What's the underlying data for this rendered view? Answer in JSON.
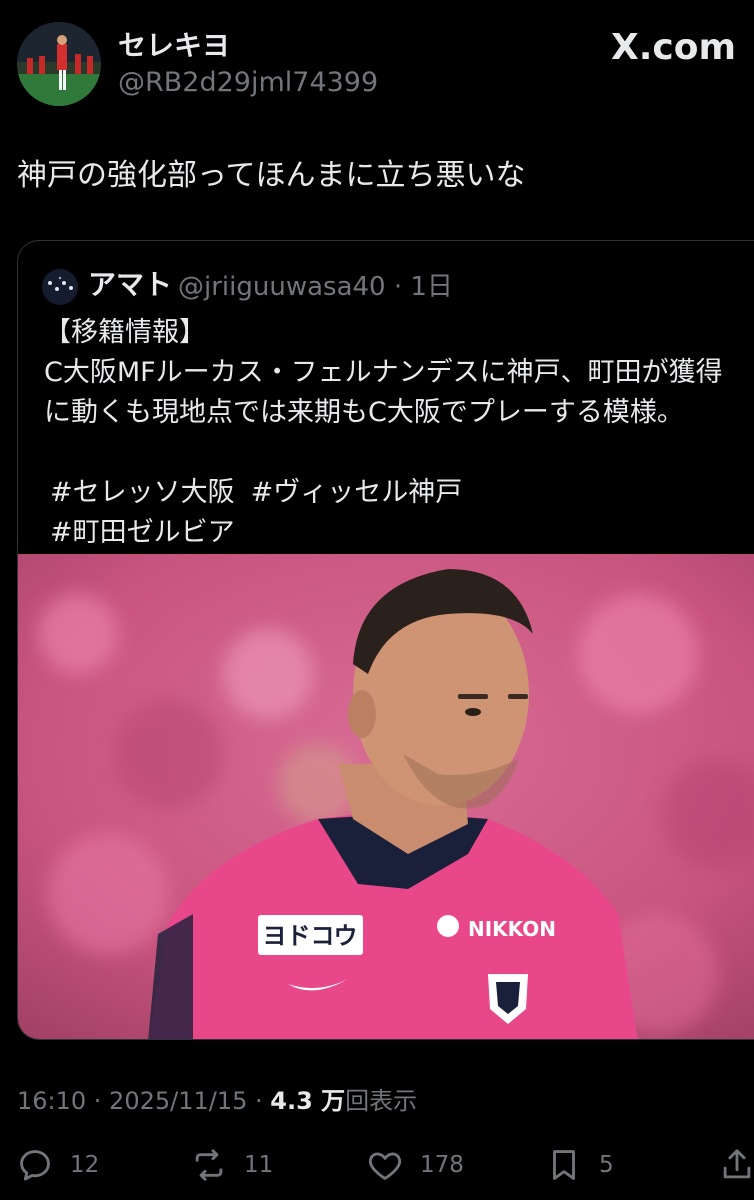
{
  "author": {
    "display_name": "セレキヨ",
    "handle": "@RB2d29jml74399",
    "avatar_icon": "soccer-players-photo"
  },
  "brand": {
    "logo_text": "X.com"
  },
  "tweet": {
    "text": "神戸の強化部ってほんまに立ち悪いな"
  },
  "quoted": {
    "name": "アマト",
    "meta": "@jriiguuwasa40 · 1日",
    "lines": [
      "【移籍情報】",
      "C大阪MFルーカス・フェルナンデスに神戸、町田が獲得",
      "に動くも現地点では来期もC大阪でプレーする模様。"
    ],
    "hashtags_line1": [
      "#セレッソ大阪",
      "#ヴィッセル神戸"
    ],
    "hashtags_line2": [
      "#町田ゼルビア"
    ],
    "photo": {
      "sponsor_text": "ヨドコウ",
      "chest_text": "NIKKON",
      "kit_color": "#e8488a"
    }
  },
  "footer": {
    "timestamp": "16:10 · 2025/11/15 · ",
    "views_number": "4.3 万",
    "views_suffix": "回表示"
  },
  "actions": {
    "reply_count": "12",
    "repost_count": "11",
    "like_count": "178",
    "bookmark_count": "5"
  },
  "colors": {
    "background": "#000000",
    "text": "#e7e9ea",
    "secondary": "#71767b",
    "border": "#2f3336"
  }
}
